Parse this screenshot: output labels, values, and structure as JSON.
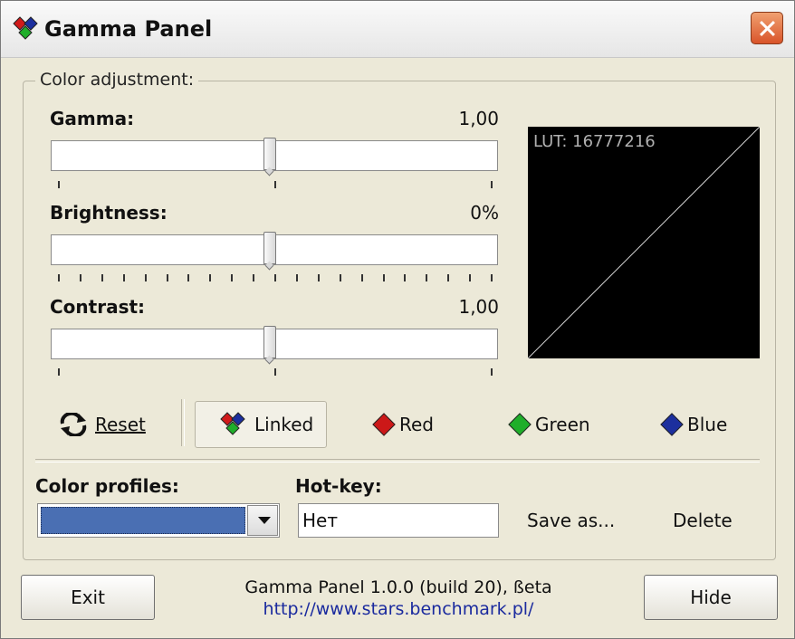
{
  "window": {
    "title": "Gamma Panel",
    "icon": "rgb-diamonds-icon",
    "close_icon": "close-icon"
  },
  "color_adjustment": {
    "legend": "Color adjustment:",
    "gamma": {
      "label": "Gamma:",
      "value": "1,00",
      "slider_fraction": 0.5
    },
    "brightness": {
      "label": "Brightness:",
      "value": "0%",
      "slider_fraction": 0.5
    },
    "contrast": {
      "label": "Contrast:",
      "value": "1,00",
      "slider_fraction": 0.5
    },
    "lut": {
      "text": "LUT: 16777216"
    }
  },
  "channels": {
    "reset": {
      "label": "Reset",
      "icon": "refresh-icon"
    },
    "linked": {
      "label": "Linked",
      "icon": "rgb-diamonds-icon"
    },
    "red": {
      "label": "Red",
      "color": "#cc1818"
    },
    "green": {
      "label": "Green",
      "color": "#1fae2a"
    },
    "blue": {
      "label": "Blue",
      "color": "#1c2f9e"
    }
  },
  "profiles": {
    "label": "Color profiles:",
    "hotkey_label": "Hot-key:",
    "hotkey_value": "Нет",
    "save_as": "Save as...",
    "delete": "Delete"
  },
  "footer": {
    "exit": "Exit",
    "hide": "Hide",
    "version": "Gamma Panel 1.0.0 (build 20), ßeta",
    "url": "http://www.stars.benchmark.pl/",
    "link_color": "#1a2a9e"
  }
}
